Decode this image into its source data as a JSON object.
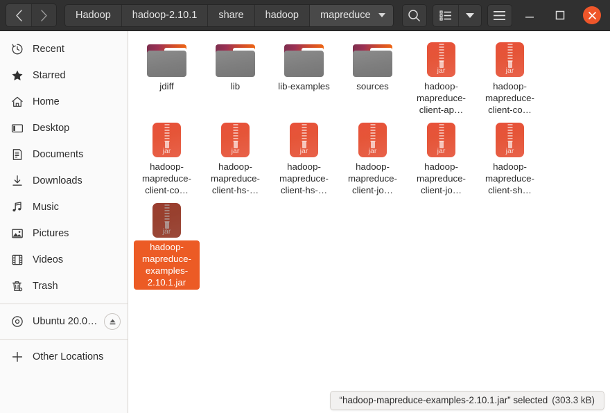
{
  "window": {
    "nav": {
      "back_icon": "chevron-left-icon",
      "forward_icon": "chevron-right-icon"
    },
    "breadcrumbs": [
      {
        "label": "Hadoop",
        "active": false
      },
      {
        "label": "hadoop-2.10.1",
        "active": false
      },
      {
        "label": "share",
        "active": false
      },
      {
        "label": "hadoop",
        "active": false
      },
      {
        "label": "mapreduce",
        "active": true
      }
    ],
    "toolbar": {
      "search_icon": "search-icon",
      "view_list_icon": "list-view-icon",
      "view_dropdown_icon": "chevron-down-icon",
      "menu_icon": "hamburger-menu-icon"
    },
    "controls": {
      "minimize_icon": "minimize-icon",
      "maximize_icon": "maximize-icon",
      "close_icon": "close-icon",
      "close_color": "#ef562a"
    }
  },
  "sidebar": {
    "items": [
      {
        "label": "Recent",
        "icon": "clock-icon"
      },
      {
        "label": "Starred",
        "icon": "star-icon"
      },
      {
        "label": "Home",
        "icon": "home-icon"
      },
      {
        "label": "Desktop",
        "icon": "desktop-icon"
      },
      {
        "label": "Documents",
        "icon": "document-icon"
      },
      {
        "label": "Downloads",
        "icon": "download-icon"
      },
      {
        "label": "Music",
        "icon": "music-note-icon"
      },
      {
        "label": "Pictures",
        "icon": "picture-icon"
      },
      {
        "label": "Videos",
        "icon": "film-icon"
      },
      {
        "label": "Trash",
        "icon": "trash-icon"
      }
    ],
    "device": {
      "label": "Ubuntu 20.0…",
      "icon": "disc-icon",
      "eject_icon": "eject-icon"
    },
    "other": {
      "label": "Other Locations",
      "icon": "plus-icon"
    }
  },
  "files": [
    {
      "name": "jdiff",
      "type": "folder",
      "selected": false
    },
    {
      "name": "lib",
      "type": "folder",
      "selected": false
    },
    {
      "name": "lib-examples",
      "type": "folder",
      "selected": false
    },
    {
      "name": "sources",
      "type": "folder",
      "selected": false
    },
    {
      "name": "hadoop-mapreduce-client-ap…",
      "type": "jar",
      "selected": false
    },
    {
      "name": "hadoop-mapreduce-client-co…",
      "type": "jar",
      "selected": false
    },
    {
      "name": "hadoop-mapreduce-client-co…",
      "type": "jar",
      "selected": false
    },
    {
      "name": "hadoop-mapreduce-client-hs-…",
      "type": "jar",
      "selected": false
    },
    {
      "name": "hadoop-mapreduce-client-hs-…",
      "type": "jar",
      "selected": false
    },
    {
      "name": "hadoop-mapreduce-client-jo…",
      "type": "jar",
      "selected": false
    },
    {
      "name": "hadoop-mapreduce-client-jo…",
      "type": "jar",
      "selected": false
    },
    {
      "name": "hadoop-mapreduce-client-sh…",
      "type": "jar",
      "selected": false
    },
    {
      "name": "hadoop-mapreduce-examples-2.10.1.jar",
      "type": "jar",
      "selected": true
    }
  ],
  "statusbar": {
    "text": "“hadoop-mapreduce-examples-2.10.1.jar” selected",
    "size": "(303.3 kB)"
  },
  "jar_icon_label": "jar"
}
